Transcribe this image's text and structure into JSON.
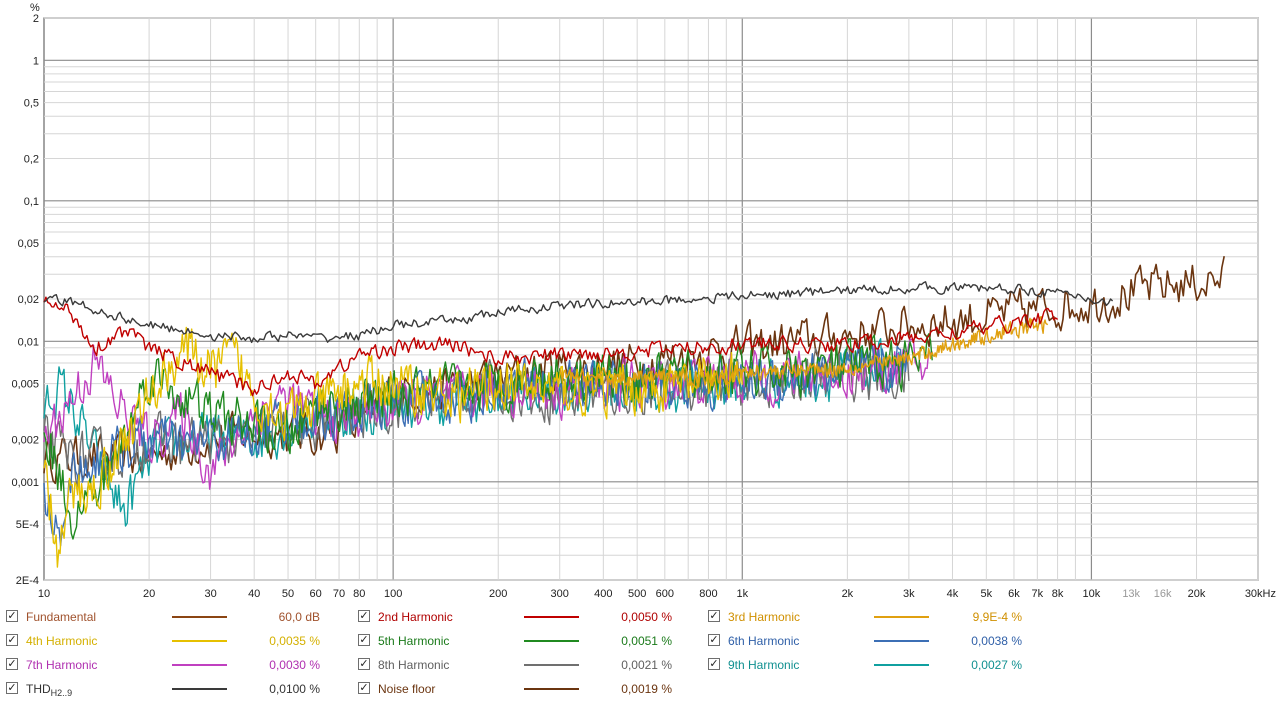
{
  "chart_data": {
    "type": "line",
    "title": "",
    "xlabel": "",
    "ylabel": "%",
    "x_scale": "log",
    "y_scale": "log",
    "xlim": [
      10,
      30000
    ],
    "ylim": [
      0.0002,
      2
    ],
    "grid": true,
    "x_ticks": [
      {
        "v": 10,
        "label": "10"
      },
      {
        "v": 20,
        "label": "20"
      },
      {
        "v": 30,
        "label": "30"
      },
      {
        "v": 40,
        "label": "40"
      },
      {
        "v": 50,
        "label": "50"
      },
      {
        "v": 60,
        "label": "60"
      },
      {
        "v": 70,
        "label": "70"
      },
      {
        "v": 80,
        "label": "80"
      },
      {
        "v": 100,
        "label": "100"
      },
      {
        "v": 200,
        "label": "200"
      },
      {
        "v": 300,
        "label": "300"
      },
      {
        "v": 400,
        "label": "400"
      },
      {
        "v": 500,
        "label": "500"
      },
      {
        "v": 600,
        "label": "600"
      },
      {
        "v": 800,
        "label": "800"
      },
      {
        "v": 1000,
        "label": "1k"
      },
      {
        "v": 2000,
        "label": "2k"
      },
      {
        "v": 3000,
        "label": "3k"
      },
      {
        "v": 4000,
        "label": "4k"
      },
      {
        "v": 5000,
        "label": "5k"
      },
      {
        "v": 6000,
        "label": "6k"
      },
      {
        "v": 7000,
        "label": "7k"
      },
      {
        "v": 8000,
        "label": "8k"
      },
      {
        "v": 10000,
        "label": "10k"
      },
      {
        "v": 13000,
        "label": "13k",
        "muted": true
      },
      {
        "v": 16000,
        "label": "16k",
        "muted": true
      },
      {
        "v": 20000,
        "label": "20k"
      },
      {
        "v": 30000,
        "label": "30kHz"
      }
    ],
    "y_ticks": [
      {
        "v": 2,
        "label": "2"
      },
      {
        "v": 1,
        "label": "1"
      },
      {
        "v": 0.5,
        "label": "0,5"
      },
      {
        "v": 0.2,
        "label": "0,2"
      },
      {
        "v": 0.1,
        "label": "0,1"
      },
      {
        "v": 0.05,
        "label": "0,05"
      },
      {
        "v": 0.02,
        "label": "0,02"
      },
      {
        "v": 0.01,
        "label": "0,01"
      },
      {
        "v": 0.005,
        "label": "0,005"
      },
      {
        "v": 0.002,
        "label": "0,002"
      },
      {
        "v": 0.001,
        "label": "0,001"
      },
      {
        "v": 0.0005,
        "label": "5E-4"
      },
      {
        "v": 0.0002,
        "label": "2E-4"
      }
    ],
    "series": [
      {
        "key": "thd",
        "color": "#3a3a3a",
        "noise": 0.05,
        "x": [
          10,
          12,
          15,
          20,
          25,
          30,
          40,
          50,
          60,
          80,
          100,
          150,
          200,
          300,
          500,
          700,
          1000,
          2000,
          3000,
          5000,
          7000,
          10000,
          11500
        ],
        "y": [
          0.02,
          0.019,
          0.016,
          0.013,
          0.012,
          0.011,
          0.0105,
          0.011,
          0.0105,
          0.011,
          0.013,
          0.014,
          0.016,
          0.018,
          0.019,
          0.02,
          0.021,
          0.023,
          0.024,
          0.024,
          0.023,
          0.02,
          0.019
        ]
      },
      {
        "key": "h2",
        "color": "#c00000",
        "noise": 0.08,
        "x": [
          10,
          12,
          14,
          17,
          20,
          25,
          30,
          40,
          50,
          60,
          80,
          100,
          150,
          200,
          300,
          500,
          700,
          1000,
          2000,
          3000,
          5000,
          7000,
          8000
        ],
        "y": [
          0.019,
          0.016,
          0.009,
          0.012,
          0.009,
          0.007,
          0.006,
          0.0045,
          0.006,
          0.005,
          0.008,
          0.009,
          0.0095,
          0.0075,
          0.008,
          0.0085,
          0.009,
          0.0095,
          0.0095,
          0.0105,
          0.0125,
          0.0145,
          0.015
        ]
      },
      {
        "key": "h3",
        "color": "#e0a010",
        "noise": 0.08,
        "x": [
          300,
          500,
          800,
          1000,
          2000,
          3000,
          4000,
          5000,
          6000,
          7000,
          7500
        ],
        "y": [
          0.0055,
          0.0055,
          0.0055,
          0.006,
          0.0065,
          0.0075,
          0.0095,
          0.011,
          0.012,
          0.013,
          0.013
        ]
      },
      {
        "key": "h4",
        "color": "#e6c000",
        "noise": 0.25,
        "x": [
          10,
          11,
          12,
          14,
          17,
          20,
          25,
          30,
          35,
          40,
          50,
          60,
          80,
          100,
          150,
          200,
          300,
          500,
          700,
          1000
        ],
        "y": [
          0.0012,
          0.0003,
          0.0008,
          0.0009,
          0.002,
          0.004,
          0.009,
          0.006,
          0.008,
          0.004,
          0.003,
          0.0035,
          0.005,
          0.005,
          0.004,
          0.005,
          0.0045,
          0.0045,
          0.005,
          0.0055
        ]
      },
      {
        "key": "h5",
        "color": "#208a20",
        "noise": 0.25,
        "x": [
          10,
          12,
          14,
          17,
          20,
          25,
          30,
          40,
          50,
          60,
          80,
          100,
          150,
          200,
          300,
          500,
          1000,
          2000,
          3500
        ],
        "y": [
          0.0025,
          0.0006,
          0.0008,
          0.002,
          0.006,
          0.004,
          0.003,
          0.0025,
          0.002,
          0.0035,
          0.0035,
          0.004,
          0.0045,
          0.005,
          0.006,
          0.0055,
          0.006,
          0.0065,
          0.0075
        ]
      },
      {
        "key": "h6",
        "color": "#3c6fb5",
        "noise": 0.25,
        "x": [
          10,
          11,
          12,
          15,
          20,
          25,
          30,
          40,
          50,
          60,
          80,
          100,
          150,
          200,
          300,
          500,
          1000,
          2000,
          3000
        ],
        "y": [
          0.0008,
          0.0004,
          0.0012,
          0.0015,
          0.002,
          0.0018,
          0.002,
          0.0022,
          0.003,
          0.0028,
          0.0032,
          0.0038,
          0.004,
          0.0045,
          0.005,
          0.0048,
          0.0052,
          0.006,
          0.0068
        ]
      },
      {
        "key": "h7",
        "color": "#c040c0",
        "noise": 0.25,
        "x": [
          10,
          12,
          14,
          17,
          20,
          25,
          30,
          40,
          50,
          60,
          80,
          100,
          150,
          200,
          300,
          500,
          1000,
          2000,
          3500
        ],
        "y": [
          0.002,
          0.004,
          0.007,
          0.003,
          0.002,
          0.003,
          0.0012,
          0.003,
          0.004,
          0.0028,
          0.003,
          0.0035,
          0.004,
          0.0045,
          0.0045,
          0.005,
          0.0055,
          0.006,
          0.007
        ]
      },
      {
        "key": "h8",
        "color": "#707070",
        "noise": 0.25,
        "x": [
          10,
          12,
          15,
          20,
          25,
          30,
          40,
          50,
          60,
          80,
          100,
          150,
          200,
          300,
          500,
          1000,
          2000,
          3000
        ],
        "y": [
          0.002,
          0.0015,
          0.0015,
          0.002,
          0.0018,
          0.002,
          0.002,
          0.0025,
          0.0025,
          0.003,
          0.0035,
          0.0042,
          0.0045,
          0.004,
          0.0045,
          0.005,
          0.006,
          0.0055
        ]
      },
      {
        "key": "h9",
        "color": "#10a0a0",
        "noise": 0.25,
        "x": [
          10,
          11,
          12,
          14,
          17,
          20,
          25,
          30,
          40,
          50,
          60,
          80,
          100,
          150,
          200,
          300,
          500,
          1000,
          2000,
          3000
        ],
        "y": [
          0.0035,
          0.0048,
          0.0035,
          0.0015,
          0.0006,
          0.0015,
          0.002,
          0.002,
          0.002,
          0.0025,
          0.003,
          0.003,
          0.0035,
          0.0038,
          0.004,
          0.0045,
          0.0045,
          0.005,
          0.0058,
          0.0065
        ]
      },
      {
        "key": "noise",
        "color": "#6b3510",
        "noise": 0.22,
        "x": [
          10,
          20,
          30,
          40,
          60,
          80,
          100,
          150,
          200,
          300,
          500,
          700,
          1000,
          2000,
          3000,
          5000,
          7000,
          10000,
          15000,
          24000
        ],
        "y": [
          0.0015,
          0.0015,
          0.002,
          0.0022,
          0.0022,
          0.0025,
          0.0045,
          0.0045,
          0.0055,
          0.0065,
          0.007,
          0.008,
          0.009,
          0.011,
          0.013,
          0.015,
          0.017,
          0.019,
          0.024,
          0.028
        ]
      }
    ]
  },
  "legend": [
    {
      "key": "fundamental",
      "name": "Fundamental",
      "value": "60,0 dB",
      "color": "#8b4513",
      "name_color": "#a0522d",
      "checked": true
    },
    {
      "key": "h2",
      "name": "2nd Harmonic",
      "value": "0,0050 %",
      "color": "#c00000",
      "name_color": "#b00000",
      "checked": true
    },
    {
      "key": "h3",
      "name": "3rd Harmonic",
      "value": "9,9E-4 %",
      "color": "#e0a010",
      "name_color": "#d09000",
      "checked": true
    },
    {
      "key": "h4",
      "name": "4th Harmonic",
      "value": "0,0035 %",
      "color": "#e6c000",
      "name_color": "#d4b000",
      "checked": true
    },
    {
      "key": "h5",
      "name": "5th Harmonic",
      "value": "0,0051 %",
      "color": "#208a20",
      "name_color": "#1a7a1a",
      "checked": true
    },
    {
      "key": "h6",
      "name": "6th Harmonic",
      "value": "0,0038 %",
      "color": "#3c6fb5",
      "name_color": "#3060a8",
      "checked": true
    },
    {
      "key": "h7",
      "name": "7th Harmonic",
      "value": "0,0030 %",
      "color": "#c040c0",
      "name_color": "#b030b0",
      "checked": true
    },
    {
      "key": "h8",
      "name": "8th Harmonic",
      "value": "0,0021 %",
      "color": "#707070",
      "name_color": "#606060",
      "checked": true
    },
    {
      "key": "h9",
      "name": "9th Harmonic",
      "value": "0,0027 %",
      "color": "#10a0a0",
      "name_color": "#109090",
      "checked": true
    },
    {
      "key": "thd",
      "name": "THD",
      "name_sub": "H2..9",
      "value": "0,0100 %",
      "color": "#3a3a3a",
      "name_color": "#333333",
      "checked": true
    },
    {
      "key": "noise",
      "name": "Noise floor",
      "value": "0,0019 %",
      "color": "#6b3510",
      "name_color": "#6b3510",
      "checked": true
    }
  ]
}
